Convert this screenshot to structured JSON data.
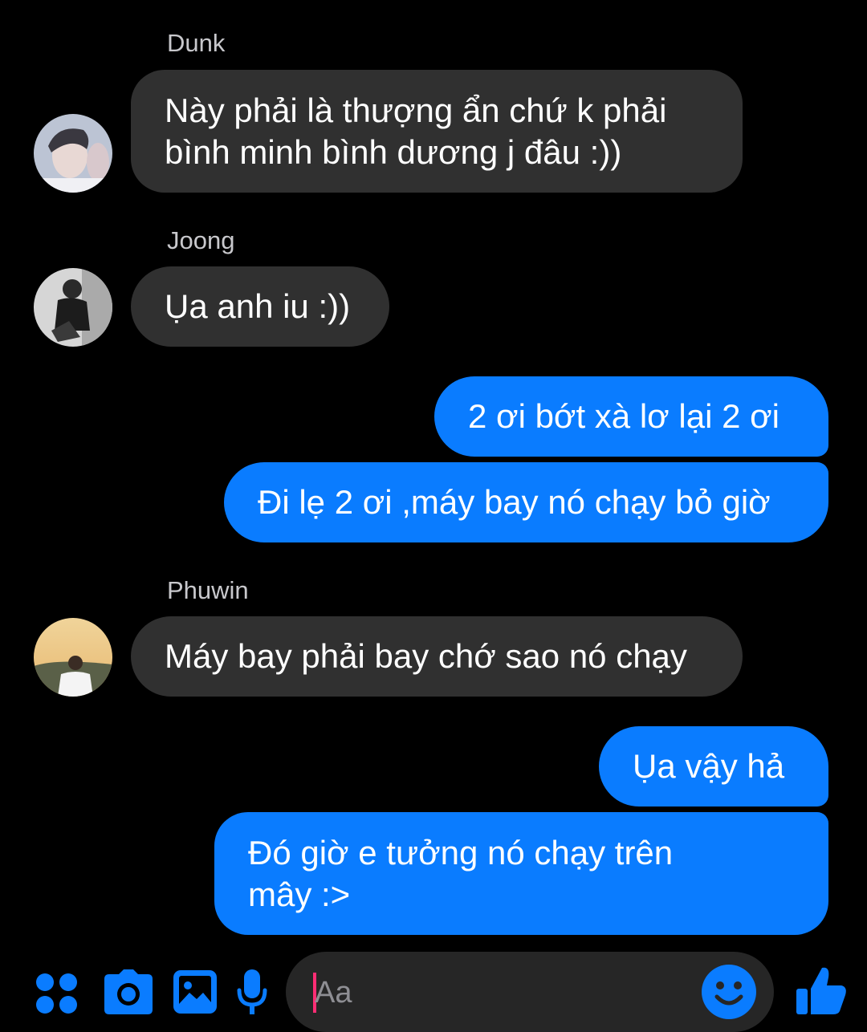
{
  "messages": [
    {
      "sender": "Dunk",
      "text_lines": [
        "Này phải là thượng ẩn chứ k phải",
        "bình minh bình dương j đâu :))"
      ]
    },
    {
      "sender": "Joong",
      "text": "Ụa anh iu :))"
    },
    {
      "sender": "me",
      "text": "2 ơi bớt xà lơ lại 2 ơi"
    },
    {
      "sender": "me",
      "text": "Đi lẹ 2 ơi ,máy bay nó chạy bỏ giờ"
    },
    {
      "sender": "Phuwin",
      "text": "Máy bay phải bay chớ sao nó chạy"
    },
    {
      "sender": "me",
      "text": "Ụa vậy hả"
    },
    {
      "sender": "me",
      "text_lines": [
        "Đó giờ e tưởng nó chạy trên",
        "mây :>"
      ]
    }
  ],
  "composer": {
    "placeholder": "Aa",
    "icons": [
      "apps-icon",
      "camera-icon",
      "gallery-icon",
      "microphone-icon",
      "emoji-icon",
      "like-icon"
    ]
  },
  "colors": {
    "background": "#000000",
    "incoming_bubble": "#303030",
    "outgoing_bubble": "#0a7cff",
    "accent": "#0a7cff",
    "caret": "#ff2d74"
  }
}
